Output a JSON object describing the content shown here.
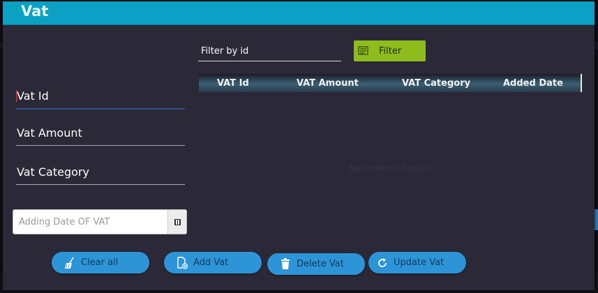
{
  "window": {
    "title": "Vat"
  },
  "form": {
    "vat_id_label": "Vat Id",
    "vat_amount_label": "Vat Amount",
    "vat_category_label": "Vat Category",
    "date_placeholder": "Adding Date OF VAT"
  },
  "filter": {
    "input_label": "Filter by  id",
    "button_label": "Filter"
  },
  "table": {
    "columns": [
      "VAT Id",
      "VAT Amount",
      "VAT Category",
      "Added Date"
    ],
    "rows": [],
    "empty_text": "No content in table"
  },
  "actions": {
    "clear_all": "Clear all",
    "add_vat": "Add Vat",
    "delete_vat": "Delete Vat",
    "update_vat": "Update Vat"
  },
  "icons": {
    "clear_all": "broom-icon",
    "add_vat": "add-document-icon",
    "delete_vat": "trash-icon",
    "update_vat": "refresh-icon",
    "filter": "filter-list-icon",
    "date": "calendar-icon"
  },
  "colors": {
    "title_bar": "#0aa1c5",
    "background": "#2b2838",
    "filter_button": "#8dbd1c",
    "action_button": "#2d95d7"
  }
}
